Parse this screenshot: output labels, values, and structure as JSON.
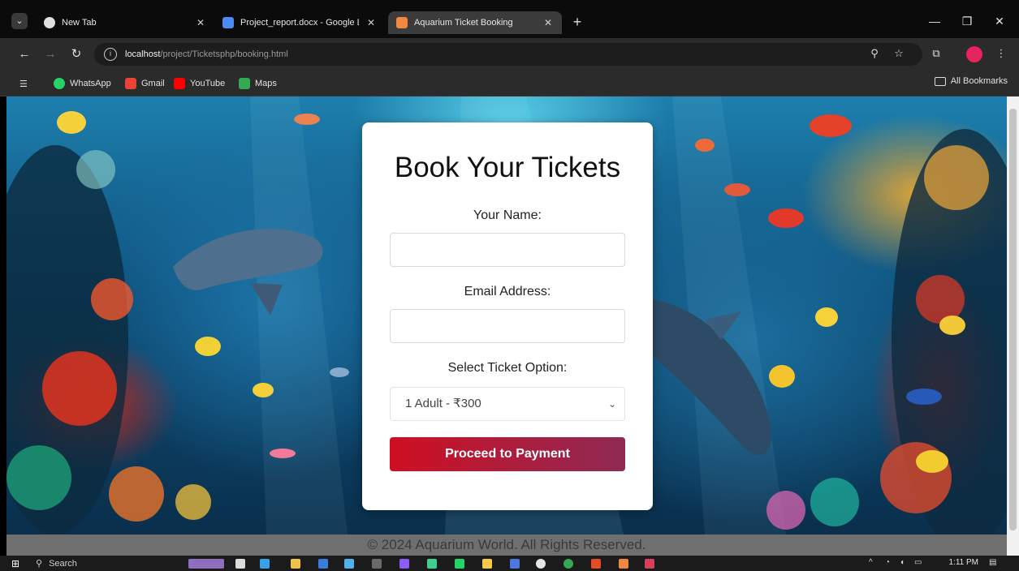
{
  "browser": {
    "tabs": [
      {
        "title": "New Tab",
        "active": false,
        "favicon_color": "#e0e0e0"
      },
      {
        "title": "Project_report.docx - Google D",
        "active": false,
        "favicon_color": "#4b8bf4"
      },
      {
        "title": "Aquarium Ticket Booking",
        "active": true,
        "favicon_color": "#f0883e"
      }
    ],
    "url_host": "localhost",
    "url_path": "/project/Ticketsphp/booking.html",
    "bookmarks": [
      {
        "label": "WhatsApp",
        "color": "#25d366"
      },
      {
        "label": "Gmail",
        "color": "#ea4335"
      },
      {
        "label": "YouTube",
        "color": "#ff0000"
      },
      {
        "label": "Maps",
        "color": "#34a853"
      }
    ],
    "all_bookmarks_label": "All Bookmarks"
  },
  "form": {
    "title": "Book Your Tickets",
    "name_label": "Your Name:",
    "name_value": "",
    "email_label": "Email Address:",
    "email_value": "",
    "ticket_label": "Select Ticket Option:",
    "ticket_selected": "1 Adult - ₹300",
    "submit_label": "Proceed to Payment"
  },
  "footer": {
    "text": "© 2024 Aquarium World. All Rights Reserved."
  },
  "taskbar": {
    "search_label": "Search",
    "time": "1:11 PM"
  },
  "colors": {
    "button_start": "#cf0f22",
    "button_end": "#8e2a55",
    "footer_bg": "#6f6f6f"
  }
}
